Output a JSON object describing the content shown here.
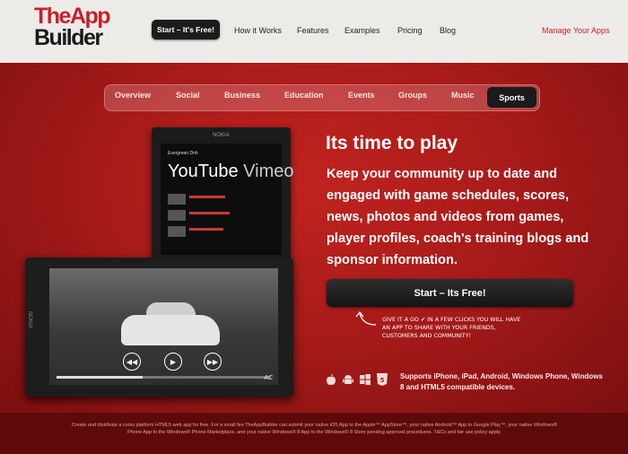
{
  "header": {
    "logo_line1": "TheApp",
    "logo_line2": "Builder",
    "start_button": "Start – It's Free!",
    "nav": [
      "How it Works",
      "Features",
      "Examples",
      "Pricing",
      "Blog"
    ],
    "manage": "Manage Your Apps"
  },
  "categories": {
    "items": [
      "Overview",
      "Social",
      "Business",
      "Education",
      "Events",
      "Groups",
      "Music"
    ],
    "active": "Sports"
  },
  "hero": {
    "headline": "Its time to play",
    "description": "Keep your community up to date and engaged with game schedules, scores, news, photos and videos from games, player profiles, coach's training blogs and sponsor information.",
    "cta": "Start – Its Free!",
    "handwritten": "Give it a go ✔ in a few clicks you will have an app to share with your friends, customers and community!",
    "supports": "Supports iPhone, iPad, Android, Windows Phone, Windows 8 and HTML5 compatible devices."
  },
  "platform_icons": [
    "apple-icon",
    "android-icon",
    "windows-icon",
    "html5-icon"
  ],
  "phone1": {
    "brand": "NOKIA",
    "small_label": "Evergreen Dnh",
    "title": "YouTube",
    "title_partial": "Vimeo"
  },
  "phone2": {
    "brand": "NOKIA",
    "watermark": "AC"
  },
  "footer": {
    "text": "Create and distribute a cross platform HTML5 web app for free. For a small fee TheAppBuilder can submit your native iOS App to the Apple™ AppStore™, your native Android™ App to Google Play™, your native Windows® Phone App to the Windows® Phone Marketplace, and your native Windows® 8 App to the Windows® 8 Store pending approval procedures. T&Cs and fair use policy apply."
  },
  "colors": {
    "brand_red": "#c8202b",
    "dark": "#1c1c1c",
    "header_bg": "#ecebe8"
  }
}
